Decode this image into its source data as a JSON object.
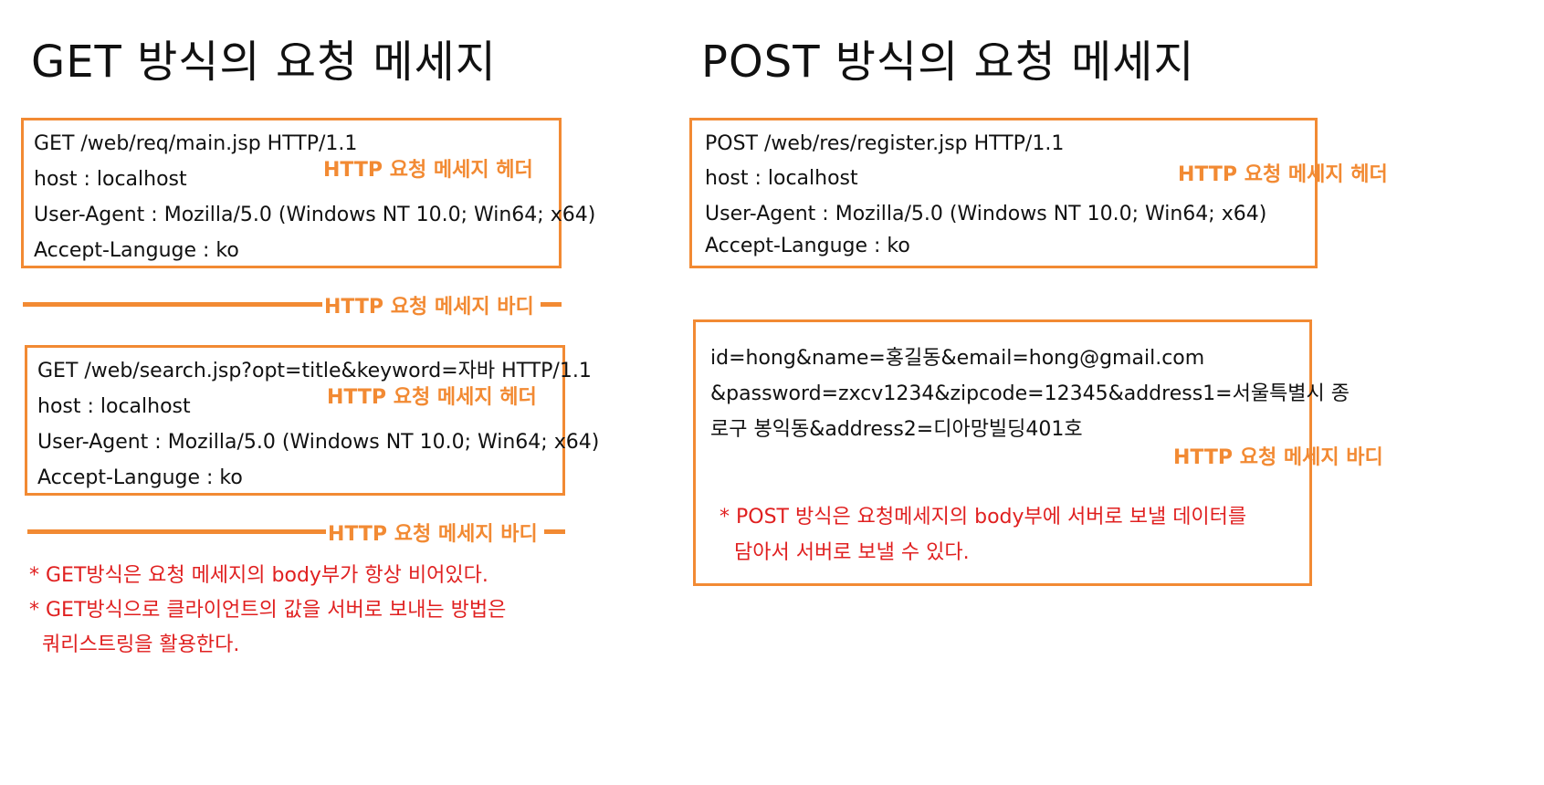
{
  "get_section": {
    "title": "GET 방식의 요청 메세지",
    "example1": {
      "request_line": "GET   /web/req/main.jsp   HTTP/1.1",
      "host": "host : localhost",
      "user_agent": "User-Agent : Mozilla/5.0 (Windows NT 10.0; Win64; x64)",
      "accept_language": "Accept-Languge : ko",
      "header_label": "HTTP 요청 메세지 헤더",
      "body_label": "HTTP 요청 메세지 바디"
    },
    "example2": {
      "request_line": "GET  /web/search.jsp?opt=title&keyword=자바   HTTP/1.1",
      "host": "host : localhost",
      "user_agent": "User-Agent : Mozilla/5.0 (Windows NT 10.0; Win64; x64)",
      "accept_language": "Accept-Languge : ko",
      "header_label": "HTTP 요청 메세지 헤더",
      "body_label": "HTTP 요청 메세지 바디"
    },
    "notes": [
      "* GET방식은 요청 메세지의 body부가 항상 비어있다.",
      "* GET방식으로 클라이언트의 값을 서버로 보내는 방법은",
      "쿼리스트링을 활용한다."
    ]
  },
  "post_section": {
    "title": "POST 방식의 요청 메세지",
    "header_box": {
      "request_line": "POST /web/res/register.jsp          HTTP/1.1",
      "host": "host : localhost",
      "user_agent": "User-Agent :  Mozilla/5.0 (Windows NT 10.0; Win64; x64)",
      "accept_language": "Accept-Languge : ko",
      "header_label": "HTTP 요청 메세지 헤더"
    },
    "body_box": {
      "lines": [
        "id=hong&name=홍길동&email=hong@gmail.com",
        "&password=zxcv1234&zipcode=12345&address1=서울특별시 종",
        "로구 봉익동&address2=디아망빌딩401호"
      ],
      "body_label": "HTTP 요청 메세지 바디",
      "notes": [
        "* POST 방식은 요청메세지의 body부에 서버로 보낼 데이터를",
        "담아서 서버로 보낼 수 있다."
      ]
    }
  },
  "colors": {
    "accent_orange": "#f28a33",
    "note_red": "#e02020"
  }
}
